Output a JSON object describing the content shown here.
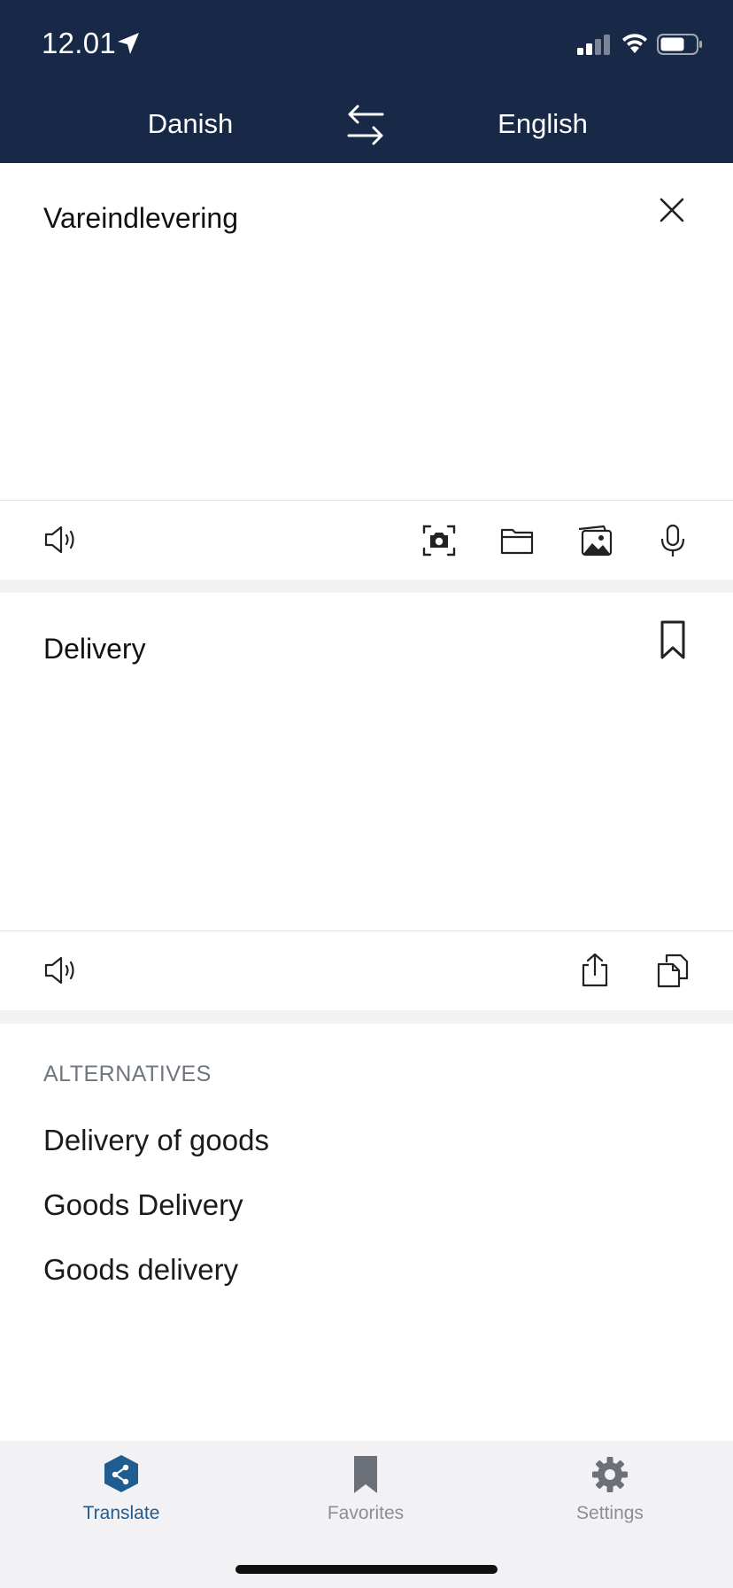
{
  "status_bar": {
    "time": "12.01"
  },
  "header": {
    "source_language": "Danish",
    "target_language": "English"
  },
  "source": {
    "text": "Vareindlevering"
  },
  "translation": {
    "text": "Delivery"
  },
  "alternatives": {
    "title": "ALTERNATIVES",
    "items": [
      "Delivery of goods",
      "Goods Delivery",
      "Goods delivery"
    ]
  },
  "tabs": [
    {
      "label": "Translate",
      "icon": "translate-logo-icon",
      "active": true
    },
    {
      "label": "Favorites",
      "icon": "bookmark-icon",
      "active": false
    },
    {
      "label": "Settings",
      "icon": "gear-icon",
      "active": false
    }
  ],
  "colors": {
    "header_bg": "#172946",
    "active_tab": "#1f5c8f",
    "inactive_tab": "#8a8e95",
    "tabbar_bg": "#f2f2f5"
  }
}
